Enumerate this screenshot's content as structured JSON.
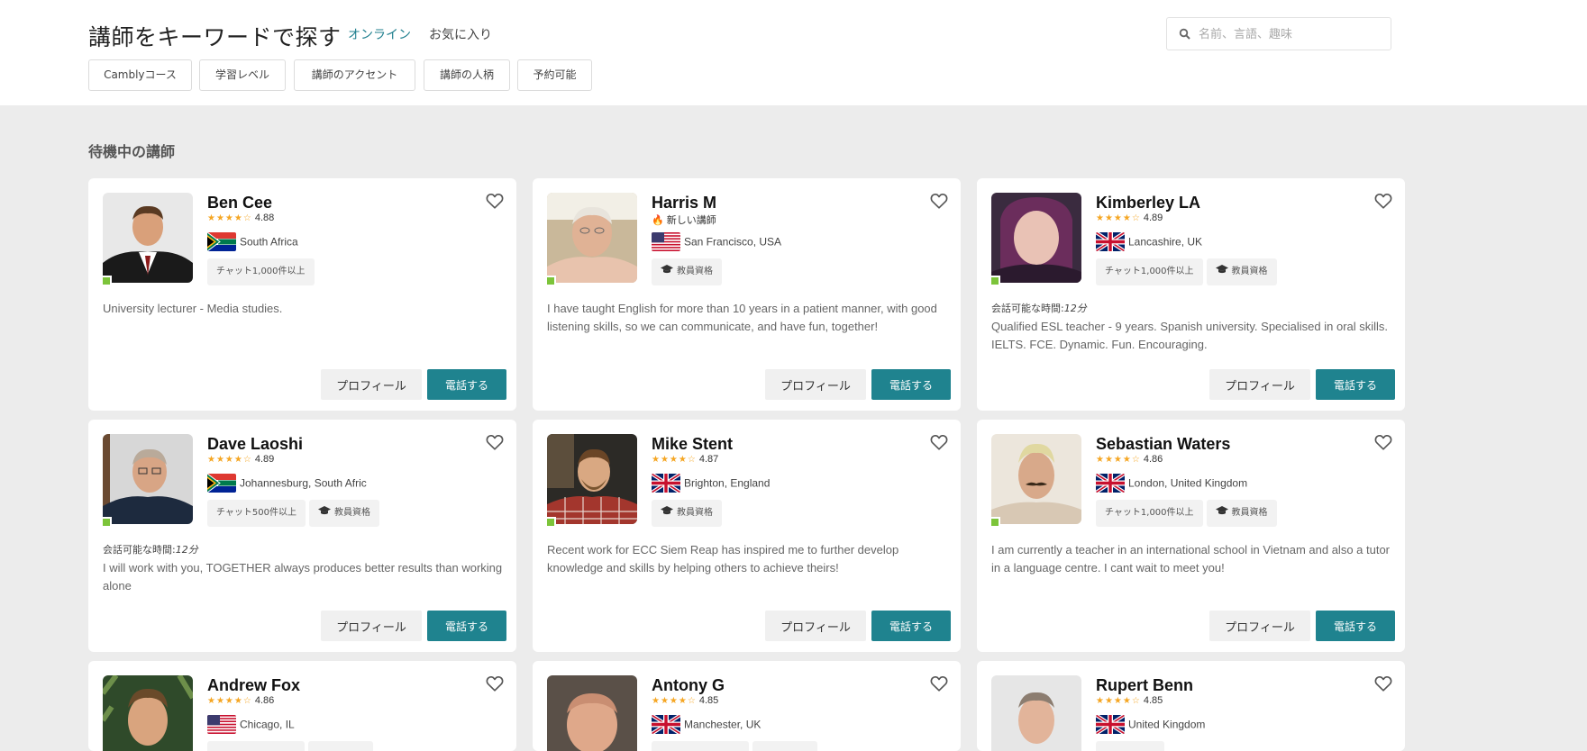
{
  "header": {
    "title": "講師をキーワードで探す",
    "tabs": [
      {
        "label": "オンライン",
        "active": true
      },
      {
        "label": "お気に入り",
        "active": false
      }
    ],
    "search_placeholder": "名前、言語、趣味"
  },
  "filters": [
    "Camblyコース",
    "学習レベル",
    "講師のアクセント",
    "講師の人柄",
    "予約可能"
  ],
  "section_title": "待機中の講師",
  "labels": {
    "profile": "プロフィール",
    "call": "電話する",
    "qualification": "教員資格",
    "talk_time_label": "会話可能な時間:",
    "new_tutor": "新しい講師"
  },
  "colors": {
    "accent": "#1f838f",
    "online": "#7cc43a",
    "star": "#f5a623"
  },
  "tutors": [
    {
      "name": "Ben Cee",
      "rating": "4.88",
      "stars": 4.5,
      "location": "South Africa",
      "flag": "za",
      "chats": "チャット1,000件以上",
      "qualified": false,
      "talk_time": "",
      "description": "University lecturer - Media studies."
    },
    {
      "name": "Harris M",
      "rating": "",
      "is_new": true,
      "stars": 0,
      "location": "San Francisco, USA",
      "flag": "us",
      "chats": "",
      "qualified": true,
      "talk_time": "",
      "description": "I have taught English for more than 10 years in a patient manner, with good listening skills, so we can communicate, and have fun, together!"
    },
    {
      "name": "Kimberley LA",
      "rating": "4.89",
      "stars": 4.5,
      "location": "Lancashire, UK",
      "flag": "uk",
      "chats": "チャット1,000件以上",
      "qualified": true,
      "talk_time": "12分",
      "description": "Qualified ESL teacher - 9 years. Spanish university. Specialised in oral skills. IELTS. FCE. Dynamic. Fun. Encouraging."
    },
    {
      "name": "Dave Laoshi",
      "rating": "4.89",
      "stars": 4.5,
      "location": "Johannesburg, South Afric",
      "flag": "za",
      "chats": "チャット500件以上",
      "qualified": true,
      "talk_time": "12分",
      "description": "I will work with you, TOGETHER always produces better results than working alone"
    },
    {
      "name": "Mike Stent",
      "rating": "4.87",
      "stars": 4.5,
      "location": "Brighton, England",
      "flag": "uk",
      "chats": "",
      "qualified": true,
      "talk_time": "",
      "description": "Recent work for ECC Siem Reap has inspired me to further develop knowledge and skills by helping others to achieve theirs!"
    },
    {
      "name": "Sebastian Waters",
      "rating": "4.86",
      "stars": 4.5,
      "location": "London, United Kingdom",
      "flag": "uk",
      "chats": "チャット1,000件以上",
      "qualified": true,
      "talk_time": "",
      "description": "I am currently a teacher in an international school in Vietnam and also a tutor in a language centre. I cant wait to meet you!"
    },
    {
      "name": "Andrew Fox",
      "rating": "4.86",
      "stars": 4.5,
      "location": "Chicago, IL",
      "flag": "us",
      "chats": "",
      "qualified": false,
      "talk_time": "",
      "description": ""
    },
    {
      "name": "Antony G",
      "rating": "4.85",
      "stars": 4.5,
      "location": "Manchester, UK",
      "flag": "uk",
      "chats": "",
      "qualified": false,
      "talk_time": "",
      "description": ""
    },
    {
      "name": "Rupert Benn",
      "rating": "4.85",
      "stars": 4.5,
      "location": "United Kingdom",
      "flag": "uk",
      "chats": "",
      "qualified": false,
      "talk_time": "",
      "description": ""
    }
  ]
}
